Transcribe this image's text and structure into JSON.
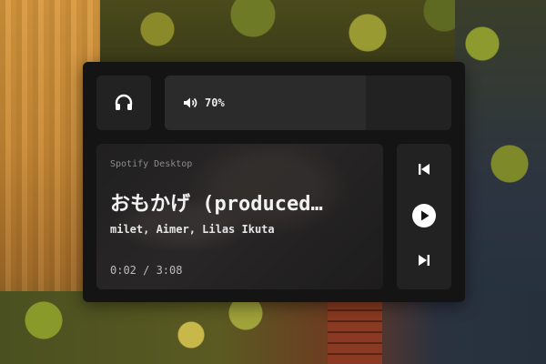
{
  "player": {
    "volume": {
      "percent": 0.7,
      "label": "70%"
    },
    "track": {
      "source": "Spotify Desktop",
      "title": "おもかげ (produced…",
      "artist": "milet, Aimer, Lilas Ikuta",
      "time": "0:02 / 3:08"
    }
  },
  "colors": {
    "panel": "#141414",
    "tile": "#222222",
    "text": "#f2f2f2",
    "muted": "#8c8c8c"
  },
  "icons": {
    "device": "headphones-icon",
    "volume": "speaker-icon",
    "previous": "skip-previous-icon",
    "play": "play-icon",
    "next": "skip-next-icon"
  }
}
